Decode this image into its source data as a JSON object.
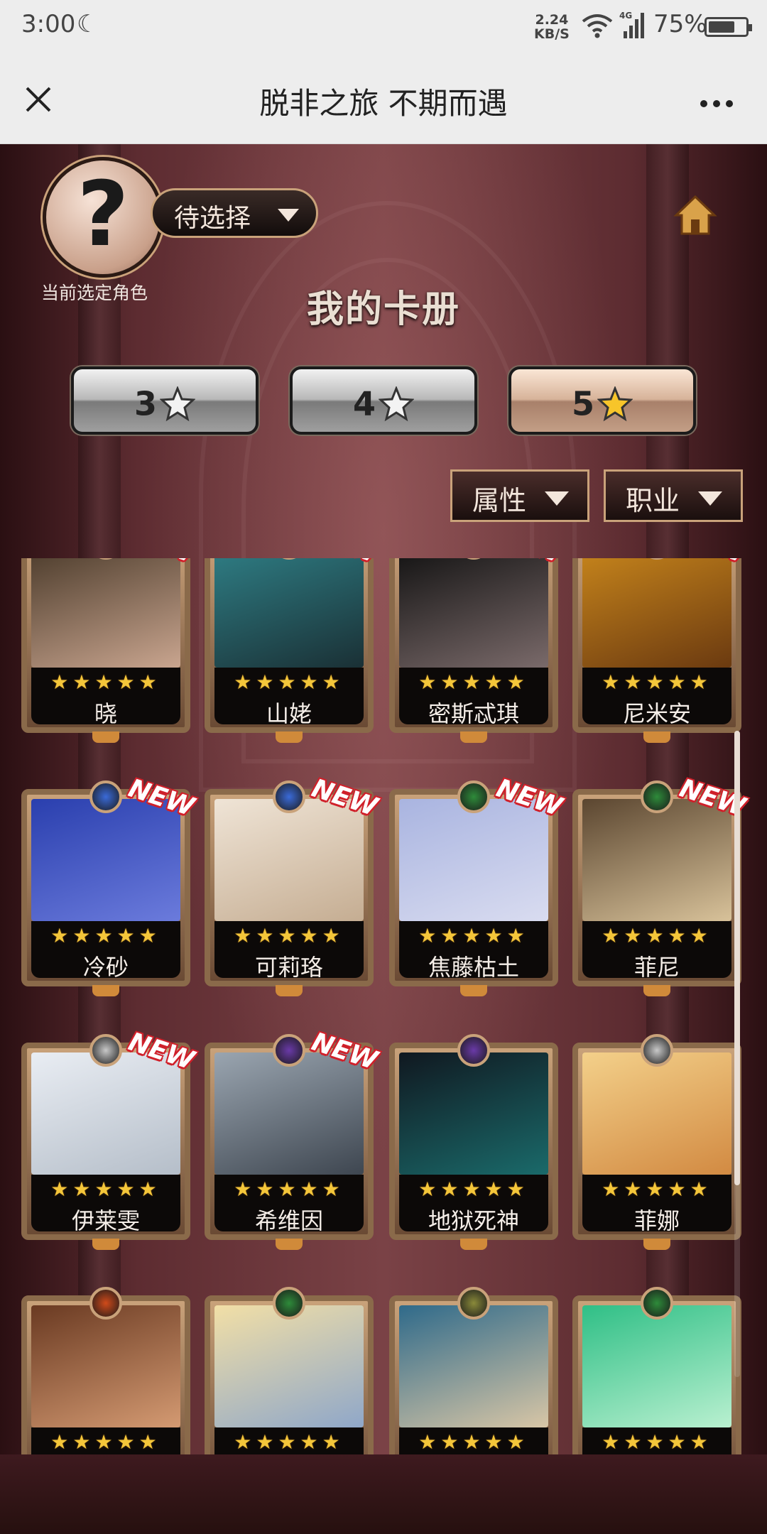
{
  "status_bar": {
    "time": "3:00",
    "speed_value": "2.24",
    "speed_unit": "KB/S",
    "network": "4G",
    "battery_percent": "75%",
    "battery_level": 0.75
  },
  "nav": {
    "title": "脱非之旅 不期而遇",
    "close_icon": "close-icon",
    "more_icon": "more-dots-icon"
  },
  "header": {
    "avatar_glyph": "?",
    "role_select_label": "待选择",
    "current_role_caption": "当前选定角色",
    "page_title": "我的卡册",
    "home_icon": "home-icon"
  },
  "star_tabs": [
    {
      "label": "3",
      "icon": "star-outline-icon",
      "selected": false
    },
    {
      "label": "4",
      "icon": "star-outline-icon",
      "selected": false
    },
    {
      "label": "5",
      "icon": "star-gold-icon",
      "selected": true
    }
  ],
  "filters": [
    {
      "label": "属性"
    },
    {
      "label": "职业"
    }
  ],
  "cards": [
    {
      "name": "晓",
      "stars": "★★★★★",
      "new": "NEW",
      "attribute": "water",
      "art": [
        "#4a3a2a",
        "#c9a58f"
      ]
    },
    {
      "name": "山姥",
      "stars": "★★★★★",
      "new": "NEW",
      "attribute": "wind",
      "art": [
        "#2f7f86",
        "#1a3035"
      ]
    },
    {
      "name": "密斯忒琪",
      "stars": "★★★★★",
      "new": "NEW",
      "attribute": "dark",
      "art": [
        "#111111",
        "#7a6a6a"
      ]
    },
    {
      "name": "尼米安",
      "stars": "★★★★★",
      "new": "NEW",
      "attribute": "earth",
      "art": [
        "#c8861c",
        "#6b3a10"
      ]
    },
    {
      "name": "冷砂",
      "stars": "★★★★★",
      "new": "NEW",
      "attribute": "water",
      "art": [
        "#2a3fae",
        "#6b7bdc"
      ]
    },
    {
      "name": "可莉珞",
      "stars": "★★★★★",
      "new": "NEW",
      "attribute": "water",
      "art": [
        "#efe4d6",
        "#c5ad92"
      ]
    },
    {
      "name": "焦藤枯土",
      "stars": "★★★★★",
      "new": "NEW",
      "attribute": "wood",
      "art": [
        "#a9b4e0",
        "#d9dcf0"
      ]
    },
    {
      "name": "菲尼",
      "stars": "★★★★★",
      "new": "NEW",
      "attribute": "wood",
      "art": [
        "#5b4630",
        "#d8c29a"
      ]
    },
    {
      "name": "伊莱雯",
      "stars": "★★★★★",
      "new": "NEW",
      "attribute": "light",
      "art": [
        "#e9edf3",
        "#b5bec9"
      ]
    },
    {
      "name": "希维因",
      "stars": "★★★★★",
      "new": "NEW",
      "attribute": "dark",
      "art": [
        "#9aa5b0",
        "#3e4650"
      ]
    },
    {
      "name": "地狱死神",
      "stars": "★★★★★",
      "new": "",
      "attribute": "dark",
      "art": [
        "#101820",
        "#1a6a6a"
      ]
    },
    {
      "name": "菲娜",
      "stars": "★★★★★",
      "new": "",
      "attribute": "light",
      "art": [
        "#f3d08a",
        "#d28a42"
      ]
    },
    {
      "name": "",
      "stars": "★★★★★",
      "new": "",
      "attribute": "fire",
      "art": [
        "#6a3a22",
        "#d49a72"
      ]
    },
    {
      "name": "",
      "stars": "★★★★★",
      "new": "",
      "attribute": "wood",
      "art": [
        "#f2dfa6",
        "#8fa7c9"
      ]
    },
    {
      "name": "",
      "stars": "★★★★★",
      "new": "",
      "attribute": "earth",
      "art": [
        "#2f6a8a",
        "#d8c6a6"
      ]
    },
    {
      "name": "",
      "stars": "★★★★★",
      "new": "",
      "attribute": "wood",
      "art": [
        "#2fbf86",
        "#b9f0d0"
      ]
    }
  ],
  "colors": {
    "gold": "#c9a27a",
    "star": "#f4c63a",
    "new_badge": "#d0202a",
    "attr_water": "#3a6ad8",
    "attr_wood": "#2e8b3a",
    "attr_dark": "#6a3aa8",
    "attr_light": "#c8c8c8",
    "attr_earth": "#8a8a3a",
    "attr_fire": "#d04a1a",
    "attr_wind": "#3ab0a0"
  }
}
